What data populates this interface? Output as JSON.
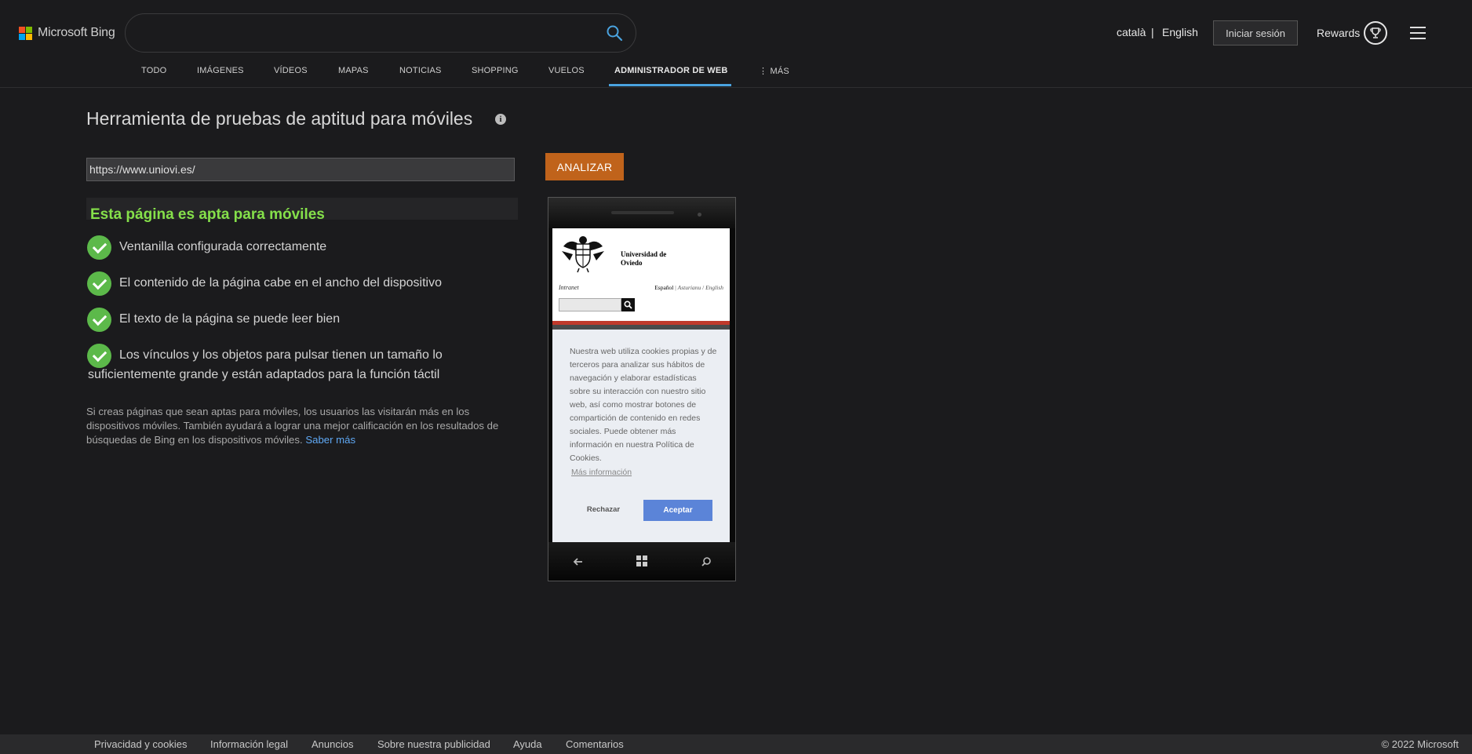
{
  "brand": {
    "logo_text": "Microsoft Bing"
  },
  "search": {
    "value": "",
    "placeholder": ""
  },
  "header": {
    "lang_catalan": "català",
    "lang_separator": "|",
    "lang_english": "English",
    "signin_label": "Iniciar sesión",
    "rewards_label": "Rewards"
  },
  "nav": {
    "items": [
      {
        "label": "TODO"
      },
      {
        "label": "IMÁGENES"
      },
      {
        "label": "VÍDEOS"
      },
      {
        "label": "MAPAS"
      },
      {
        "label": "NOTICIAS"
      },
      {
        "label": "SHOPPING"
      },
      {
        "label": "VUELOS"
      },
      {
        "label": "ADMINISTRADOR DE WEB",
        "active": true
      },
      {
        "label": "⋮ MÁS"
      }
    ]
  },
  "main": {
    "title": "Herramienta de pruebas de aptitud para móviles",
    "info_icon_glyph": "i",
    "url_value": "https://www.uniovi.es/",
    "analyze_label": "ANALIZAR",
    "result_title": "Esta página es apta para móviles",
    "checks": [
      "Ventanilla configurada correctamente",
      "El contenido de la página cabe en el ancho del dispositivo",
      "El texto de la página se puede leer bien",
      "Los vínculos y los objetos para pulsar tienen un tamaño lo suficientemente grande y están adaptados para la función táctil"
    ],
    "info_text": "Si creas páginas que sean aptas para móviles, los usuarios las visitarán más en los dispositivos móviles. También ayudará a lograr una mejor calificación en los resultados de búsquedas de Bing en los dispositivos móviles.",
    "learn_more": "Saber más"
  },
  "phone_preview": {
    "uni_name_line1": "Universidad de",
    "uni_name_line2": "Oviedo",
    "intranet": "Intranet",
    "lang_es": "Español",
    "lang_sep1": " | ",
    "lang_ast": "Asturianu",
    "lang_sep2": " / ",
    "lang_en": "English",
    "cookie_text": "Nuestra web utiliza cookies propias y de terceros para analizar sus hábitos de navegación y elaborar estadísticas sobre su interacción con nuestro sitio web, así como mostrar botones de compartición de contenido en redes sociales. Puede obtener más información en nuestra Política de Cookies.",
    "cookie_more": "Más información",
    "reject_label": "Rechazar",
    "accept_label": "Aceptar"
  },
  "footer": {
    "links": [
      "Privacidad y cookies",
      "Información legal",
      "Anuncios",
      "Sobre nuestra publicidad",
      "Ayuda",
      "Comentarios"
    ],
    "copyright": "© 2022 Microsoft"
  },
  "colors": {
    "accent_blue": "#4aa3df",
    "analyze_orange": "#c0631b",
    "success_green": "#85e04a",
    "check_green": "#5cb94a",
    "link_blue": "#5fa8f4",
    "accept_blue": "#5b84d8"
  }
}
